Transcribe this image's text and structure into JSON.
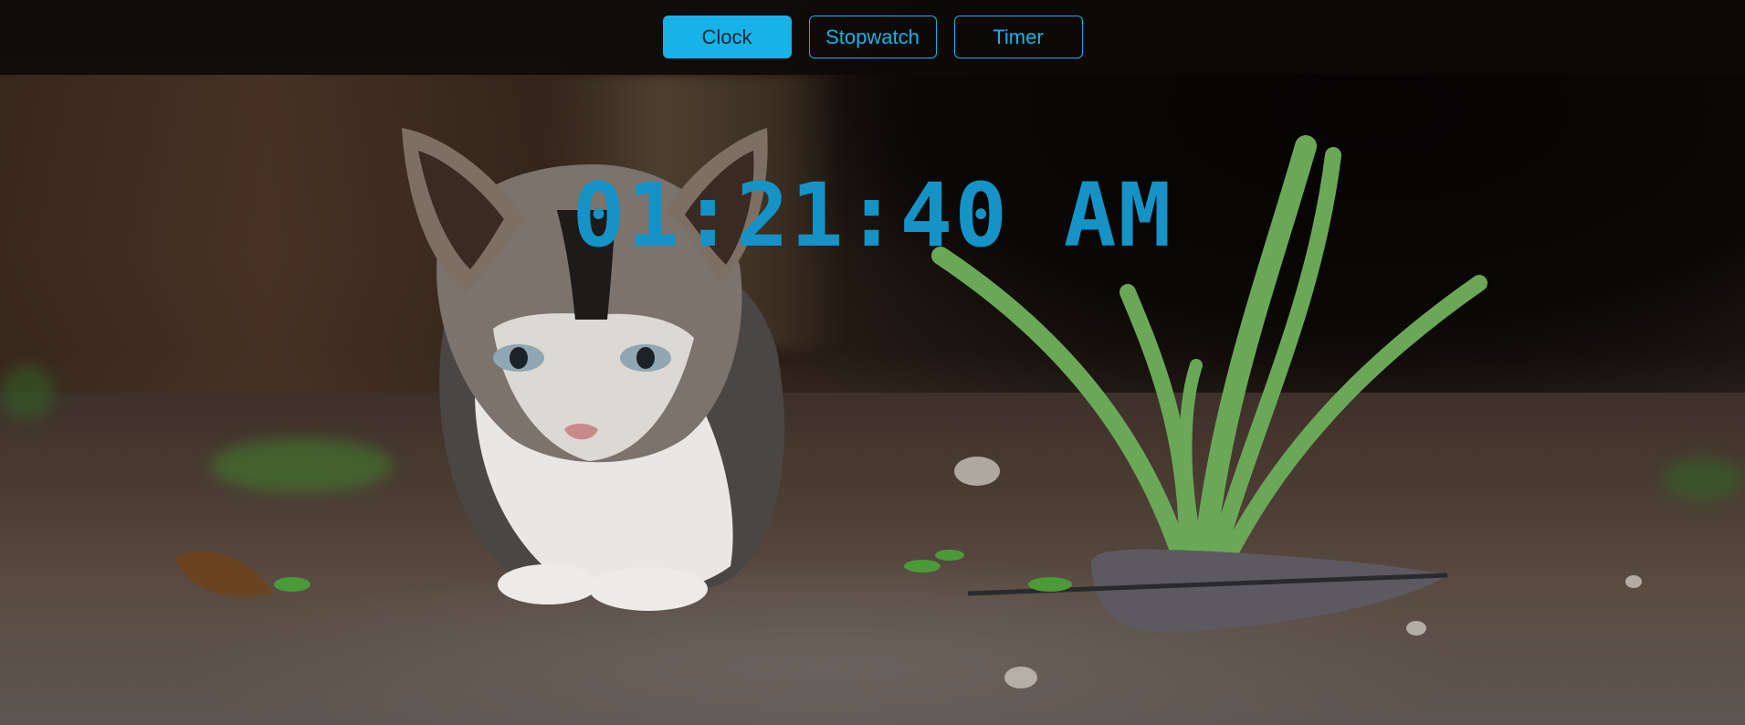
{
  "nav": {
    "tabs": [
      {
        "label": "Clock",
        "active": true
      },
      {
        "label": "Stopwatch",
        "active": false
      },
      {
        "label": "Timer",
        "active": false
      }
    ]
  },
  "clock": {
    "time": "01:21:40 AM"
  },
  "colors": {
    "accent": "#16b2e8",
    "clock_text": "#1593c6"
  },
  "background": {
    "image": "kitten-photo"
  }
}
